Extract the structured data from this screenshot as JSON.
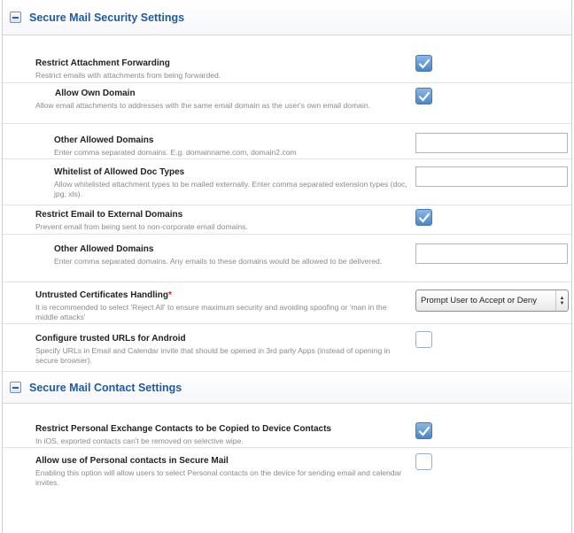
{
  "sections": {
    "mail_security": {
      "title": "Secure Mail Security Settings",
      "rows": {
        "restrict_forwarding": {
          "label": "Restrict Attachment Forwarding",
          "desc": "Restrict emails with attachments from being forwarded.",
          "checked": true
        },
        "allow_own_domain": {
          "label": "Allow Own Domain",
          "desc": "Allow email attachments to addresses with the same email domain as the user's own email domain.",
          "checked": true
        },
        "other_domains_1": {
          "label": "Other Allowed Domains",
          "desc": "Enter comma separated domains. E.g. domainname.com, domain2.com",
          "value": ""
        },
        "whitelist_doc_types": {
          "label": "Whitelist of Allowed Doc Types",
          "desc": "Allow whitelisted attachment types to be mailed externally. Enter comma separated extension types (doc, jpg, xls).",
          "value": ""
        },
        "restrict_external": {
          "label": "Restrict Email to External Domains",
          "desc": "Prevent email from being sent to non-corporate email domains.",
          "checked": true
        },
        "other_domains_2": {
          "label": "Other Allowed Domains",
          "desc": "Enter comma separated domains. Any emails to these domains would be allowed to be delivered.",
          "value": ""
        },
        "untrusted_certs": {
          "label": "Untrusted Certificates Handling",
          "required_mark": "*",
          "desc": "It is recommended to select 'Reject All' to ensure maximum security and avoiding spoofing or 'man in the middle attacks'",
          "selected": "Prompt User to Accept or Deny"
        },
        "trusted_urls_android": {
          "label": "Configure trusted URLs for Android",
          "desc": "Specify URLs in Email and Calendar invite that should be opened in 3rd party Apps (instead of opening in secure browser).",
          "checked": false
        }
      }
    },
    "mail_contact": {
      "title": "Secure Mail Contact Settings",
      "rows": {
        "restrict_personal_exchange": {
          "label": "Restrict Personal Exchange Contacts to be Copied to Device Contacts",
          "desc": "In iOS, exported contacts can't be removed on selective wipe.",
          "checked": true
        },
        "allow_personal_contacts": {
          "label": "Allow use of Personal contacts in Secure Mail",
          "desc": "Enabling this option will allow users to select Personal contacts on the device for sending email and calendar invites.",
          "checked": false
        }
      }
    }
  },
  "icons": {
    "collapse": "minus-collapse-icon",
    "check": "checkmark-icon",
    "select_arrows": "up-down-arrows-icon"
  },
  "colors": {
    "section_title": "#1f5ba4",
    "checkbox_on": "#4b86c9",
    "required": "#d21f1f"
  }
}
